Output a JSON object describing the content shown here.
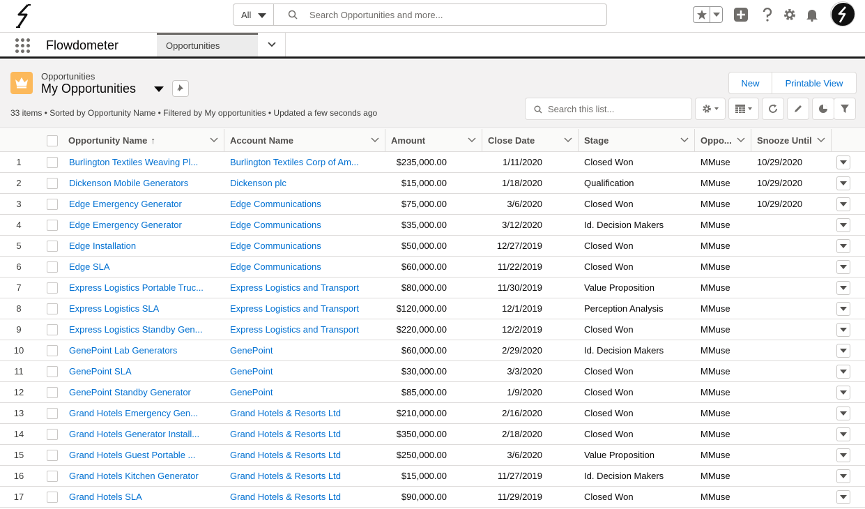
{
  "global_header": {
    "search_scope": "All",
    "search_placeholder": "Search Opportunities and more..."
  },
  "nav": {
    "app_name": "Flowdometer",
    "tab_label": "Opportunities"
  },
  "list_header": {
    "object_label": "Opportunities",
    "list_view_name": "My Opportunities",
    "info": "33 items • Sorted by Opportunity Name • Filtered by My opportunities • Updated a few seconds ago",
    "new_button": "New",
    "printable_view_button": "Printable View",
    "search_placeholder": "Search this list..."
  },
  "table": {
    "columns": {
      "opportunity_name": "Opportunity Name",
      "account_name": "Account Name",
      "amount": "Amount",
      "close_date": "Close Date",
      "stage": "Stage",
      "owner": "Oppo...",
      "snooze_until": "Snooze Until"
    },
    "sort_indicator": "↑",
    "rows": [
      {
        "n": "1",
        "name": "Burlington Textiles Weaving Pl...",
        "account": "Burlington Textiles Corp of Am...",
        "amount": "$235,000.00",
        "close": "1/11/2020",
        "stage": "Closed Won",
        "owner": "MMuse",
        "snooze": "10/29/2020"
      },
      {
        "n": "2",
        "name": "Dickenson Mobile Generators",
        "account": "Dickenson plc",
        "amount": "$15,000.00",
        "close": "1/18/2020",
        "stage": "Qualification",
        "owner": "MMuse",
        "snooze": "10/29/2020"
      },
      {
        "n": "3",
        "name": "Edge Emergency Generator",
        "account": "Edge Communications",
        "amount": "$75,000.00",
        "close": "3/6/2020",
        "stage": "Closed Won",
        "owner": "MMuse",
        "snooze": "10/29/2020"
      },
      {
        "n": "4",
        "name": "Edge Emergency Generator",
        "account": "Edge Communications",
        "amount": "$35,000.00",
        "close": "3/12/2020",
        "stage": "Id. Decision Makers",
        "owner": "MMuse",
        "snooze": ""
      },
      {
        "n": "5",
        "name": "Edge Installation",
        "account": "Edge Communications",
        "amount": "$50,000.00",
        "close": "12/27/2019",
        "stage": "Closed Won",
        "owner": "MMuse",
        "snooze": ""
      },
      {
        "n": "6",
        "name": "Edge SLA",
        "account": "Edge Communications",
        "amount": "$60,000.00",
        "close": "11/22/2019",
        "stage": "Closed Won",
        "owner": "MMuse",
        "snooze": ""
      },
      {
        "n": "7",
        "name": "Express Logistics Portable Truc...",
        "account": "Express Logistics and Transport",
        "amount": "$80,000.00",
        "close": "11/30/2019",
        "stage": "Value Proposition",
        "owner": "MMuse",
        "snooze": ""
      },
      {
        "n": "8",
        "name": "Express Logistics SLA",
        "account": "Express Logistics and Transport",
        "amount": "$120,000.00",
        "close": "12/1/2019",
        "stage": "Perception Analysis",
        "owner": "MMuse",
        "snooze": ""
      },
      {
        "n": "9",
        "name": "Express Logistics Standby Gen...",
        "account": "Express Logistics and Transport",
        "amount": "$220,000.00",
        "close": "12/2/2019",
        "stage": "Closed Won",
        "owner": "MMuse",
        "snooze": ""
      },
      {
        "n": "10",
        "name": "GenePoint Lab Generators",
        "account": "GenePoint",
        "amount": "$60,000.00",
        "close": "2/29/2020",
        "stage": "Id. Decision Makers",
        "owner": "MMuse",
        "snooze": ""
      },
      {
        "n": "11",
        "name": "GenePoint SLA",
        "account": "GenePoint",
        "amount": "$30,000.00",
        "close": "3/3/2020",
        "stage": "Closed Won",
        "owner": "MMuse",
        "snooze": ""
      },
      {
        "n": "12",
        "name": "GenePoint Standby Generator",
        "account": "GenePoint",
        "amount": "$85,000.00",
        "close": "1/9/2020",
        "stage": "Closed Won",
        "owner": "MMuse",
        "snooze": ""
      },
      {
        "n": "13",
        "name": "Grand Hotels Emergency Gen...",
        "account": "Grand Hotels & Resorts Ltd",
        "amount": "$210,000.00",
        "close": "2/16/2020",
        "stage": "Closed Won",
        "owner": "MMuse",
        "snooze": ""
      },
      {
        "n": "14",
        "name": "Grand Hotels Generator Install...",
        "account": "Grand Hotels & Resorts Ltd",
        "amount": "$350,000.00",
        "close": "2/18/2020",
        "stage": "Closed Won",
        "owner": "MMuse",
        "snooze": ""
      },
      {
        "n": "15",
        "name": "Grand Hotels Guest Portable ...",
        "account": "Grand Hotels & Resorts Ltd",
        "amount": "$250,000.00",
        "close": "3/6/2020",
        "stage": "Value Proposition",
        "owner": "MMuse",
        "snooze": ""
      },
      {
        "n": "16",
        "name": "Grand Hotels Kitchen Generator",
        "account": "Grand Hotels & Resorts Ltd",
        "amount": "$15,000.00",
        "close": "11/27/2019",
        "stage": "Id. Decision Makers",
        "owner": "MMuse",
        "snooze": ""
      },
      {
        "n": "17",
        "name": "Grand Hotels SLA",
        "account": "Grand Hotels & Resorts Ltd",
        "amount": "$90,000.00",
        "close": "11/29/2019",
        "stage": "Closed Won",
        "owner": "MMuse",
        "snooze": ""
      }
    ]
  },
  "colors": {
    "link": "#0070d2",
    "object_icon": "#fcb95b",
    "header_bg": "#f3f2f2"
  },
  "icons": [
    "logo-icon",
    "search-icon",
    "star-icon",
    "add-icon",
    "help-icon",
    "gear-icon",
    "bell-icon",
    "waffle-icon",
    "crown-icon",
    "pin-icon",
    "table-icon",
    "refresh-icon",
    "edit-icon",
    "chart-icon",
    "filter-icon",
    "chevron-down-icon"
  ]
}
